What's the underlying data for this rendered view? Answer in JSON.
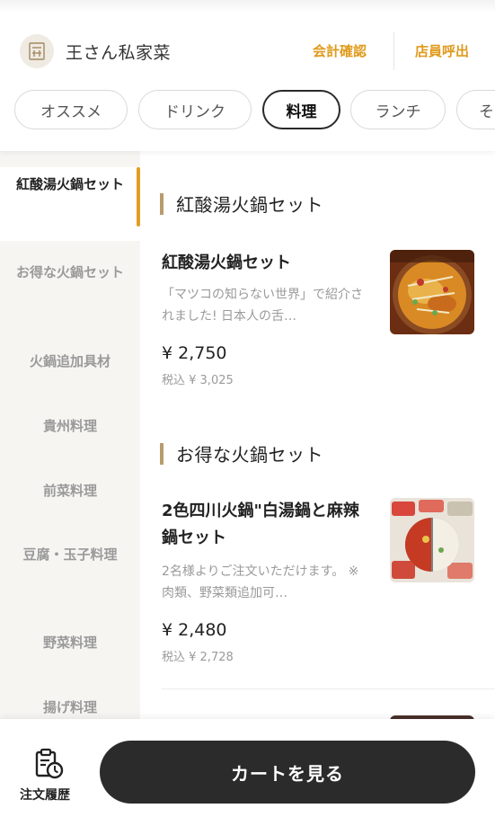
{
  "header": {
    "store_name": "王さん私家菜",
    "checkout_label": "会計確認",
    "call_staff_label": "店員呼出",
    "accent_color": "#e09a1c"
  },
  "tabs": [
    {
      "label": "オススメ",
      "active": false
    },
    {
      "label": "ドリンク",
      "active": false
    },
    {
      "label": "料理",
      "active": true
    },
    {
      "label": "ランチ",
      "active": false
    },
    {
      "label": "そ",
      "active": false
    }
  ],
  "sidebar": {
    "items": [
      {
        "label": "紅酸湯火鍋セット",
        "active": true
      },
      {
        "label": "お得な火鍋セット",
        "active": false
      },
      {
        "label": "火鍋追加具材",
        "active": false
      },
      {
        "label": "貴州料理",
        "active": false
      },
      {
        "label": "前菜料理",
        "active": false
      },
      {
        "label": "豆腐・玉子料理",
        "active": false
      },
      {
        "label": "野菜料理",
        "active": false
      },
      {
        "label": "揚げ料理",
        "active": false
      }
    ]
  },
  "sections": [
    {
      "title": "紅酸湯火鍋セット",
      "items": [
        {
          "name": "紅酸湯火鍋セット",
          "description": "「マツコの知らない世界」で紹介されました! 日本人の舌…",
          "price": "¥ 2,750",
          "tax_price": "税込 ¥ 3,025",
          "image": "red-sour-soup-hotpot-photo"
        }
      ]
    },
    {
      "title": "お得な火鍋セット",
      "items": [
        {
          "name": "2色四川火鍋\"白湯鍋と麻辣鍋セット",
          "description": "2名様よりご注文いただけます。 ※肉類、野菜類追加可…",
          "price": "¥ 2,480",
          "tax_price": "税込 ¥ 2,728",
          "image": "two-color-sichuan-hotpot-photo"
        }
      ]
    }
  ],
  "bottom_bar": {
    "history_label": "注文履歴",
    "history_icon": "order-history-icon",
    "cart_label": "カートを見る"
  }
}
